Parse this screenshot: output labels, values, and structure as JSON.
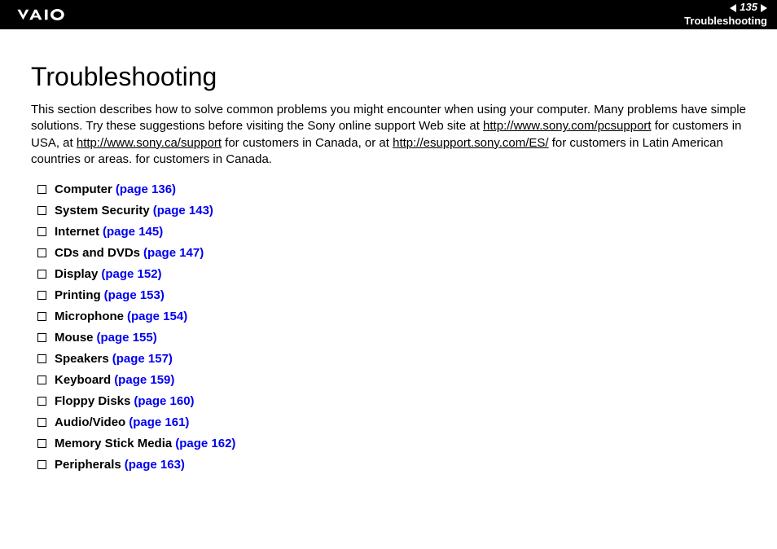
{
  "header": {
    "page_number": "135",
    "breadcrumb": "Troubleshooting"
  },
  "title": "Troubleshooting",
  "intro": {
    "text1": "This section describes how to solve common problems you might encounter when using your computer. Many problems have simple solutions. Try these suggestions before visiting the Sony online support Web site at ",
    "link1": "http://www.sony.com/pcsupport",
    "text2": " for customers in USA, at ",
    "link2": "http://www.sony.ca/support",
    "text3": " for customers in Canada, or at ",
    "link3": "http://esupport.sony.com/ES/",
    "text4": " for customers in Latin American countries or areas. for customers in Canada."
  },
  "toc": [
    {
      "label": "Computer",
      "page": "(page 136)"
    },
    {
      "label": "System Security",
      "page": "(page 143)"
    },
    {
      "label": "Internet",
      "page": "(page 145)"
    },
    {
      "label": "CDs and DVDs",
      "page": "(page 147)"
    },
    {
      "label": "Display",
      "page": "(page 152)"
    },
    {
      "label": "Printing",
      "page": "(page 153)"
    },
    {
      "label": "Microphone",
      "page": "(page 154)"
    },
    {
      "label": "Mouse",
      "page": "(page 155)"
    },
    {
      "label": "Speakers",
      "page": "(page 157)"
    },
    {
      "label": "Keyboard",
      "page": "(page 159)"
    },
    {
      "label": "Floppy Disks",
      "page": "(page 160)"
    },
    {
      "label": "Audio/Video",
      "page": "(page 161)"
    },
    {
      "label": "Memory Stick Media",
      "page": "(page 162)"
    },
    {
      "label": "Peripherals",
      "page": "(page 163)"
    }
  ]
}
